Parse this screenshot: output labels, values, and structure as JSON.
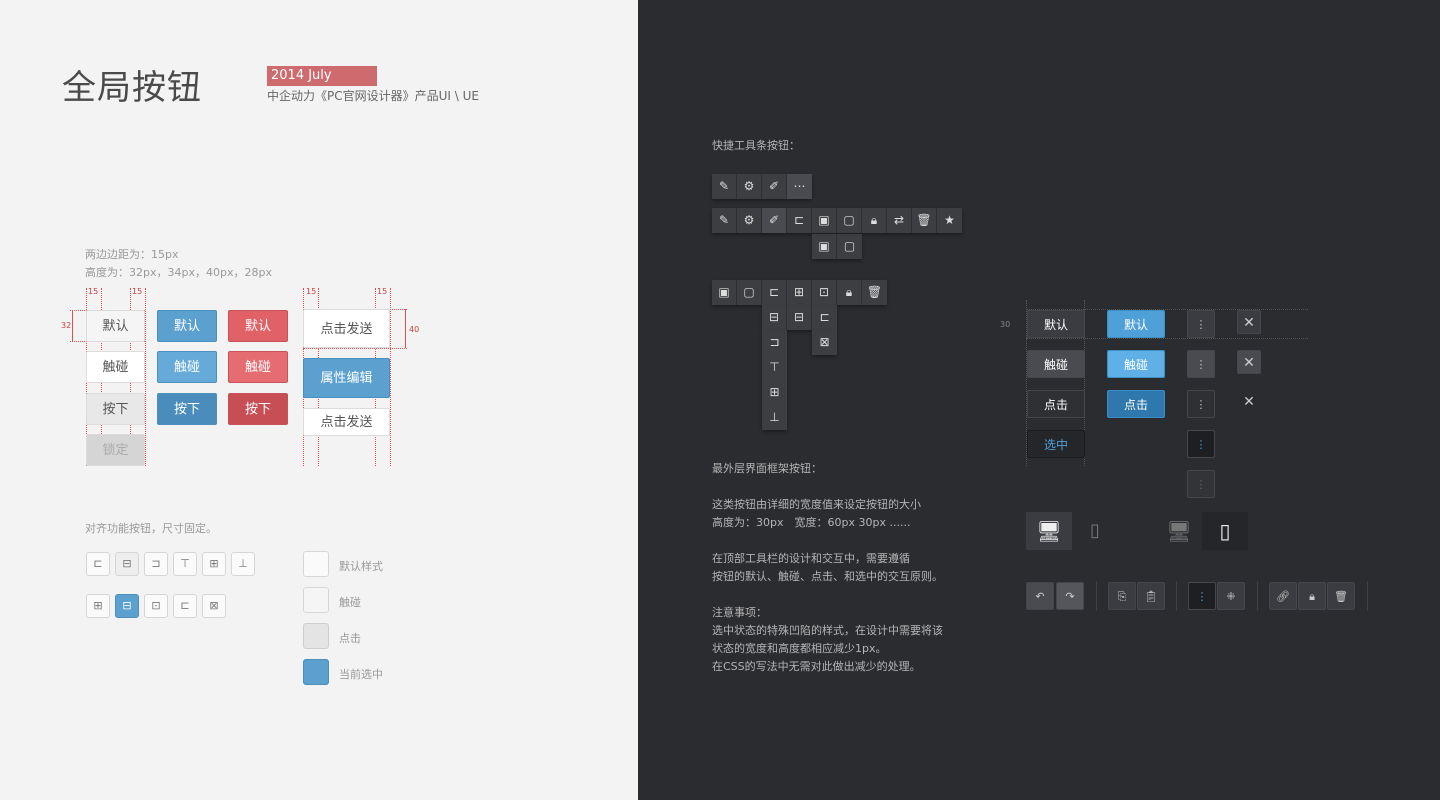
{
  "header": {
    "title": "全局按钮",
    "tag": "2014 July",
    "subtitle": "中企动力《PC官网设计器》产品UI \\ UE"
  },
  "specs": {
    "margin_note": "两边边距为：15px",
    "height_note": "高度为：32px，34px，40px，28px",
    "dim_15": "15",
    "dim_32": "32",
    "dim_40": "40",
    "dim_30": "30"
  },
  "left_buttons": {
    "default": "默认",
    "hover": "触碰",
    "pressed": "按下",
    "locked": "锁定",
    "send": "点击发送",
    "edit": "属性编辑"
  },
  "align_section": {
    "note": "对齐功能按钮，尺寸固定。"
  },
  "legend": {
    "default_style": "默认样式",
    "hover": "触碰",
    "click": "点击",
    "current": "当前选中"
  },
  "dark": {
    "toolbar_title": "快捷工具条按钮：",
    "frame_title": "最外层界面框架按钮：",
    "desc1": "这类按钮由详细的宽度值来设定按钮的大小",
    "desc2": "高度为：30px　宽度：60px 30px ......",
    "desc3": "在顶部工具栏的设计和交互中，需要遵循",
    "desc4": "按钮的默认、触碰、点击、和选中的交互原则。",
    "note_title": "注意事项：",
    "note1": "选中状态的特殊凹陷的样式，在设计中需要将该",
    "note2": "状态的宽度和高度都相应减少1px。",
    "note3": "在CSS的写法中无需对此做出减少的处理。",
    "btn_default": "默认",
    "btn_hover": "触碰",
    "btn_click": "点击",
    "btn_selected": "选中"
  },
  "colors": {
    "left_bg": "#f3f3f3",
    "right_bg": "#2b2c30",
    "accent_blue": "#5ba0cf",
    "accent_red": "#e06166",
    "tag_red": "#cd6b6f"
  }
}
